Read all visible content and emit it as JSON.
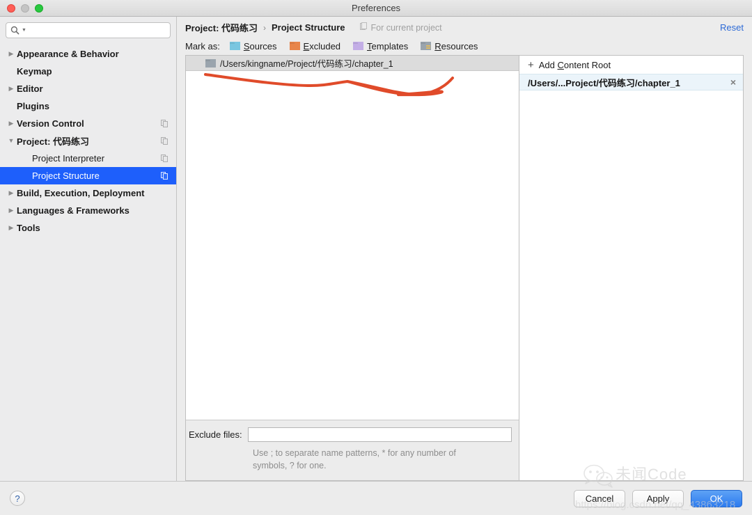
{
  "window": {
    "title": "Preferences",
    "traffic_lights": [
      "close-button",
      "minimize-button",
      "zoom-button"
    ]
  },
  "sidebar": {
    "search": {
      "value": "",
      "placeholder": "",
      "icon": "search-icon"
    },
    "items": [
      {
        "label": "Appearance & Behavior",
        "expandable": true,
        "expanded": false,
        "child": false,
        "selected": false,
        "badge": false
      },
      {
        "label": "Keymap",
        "expandable": false,
        "expanded": false,
        "child": false,
        "selected": false,
        "badge": false
      },
      {
        "label": "Editor",
        "expandable": true,
        "expanded": false,
        "child": false,
        "selected": false,
        "badge": false
      },
      {
        "label": "Plugins",
        "expandable": false,
        "expanded": false,
        "child": false,
        "selected": false,
        "badge": false
      },
      {
        "label": "Version Control",
        "expandable": true,
        "expanded": false,
        "child": false,
        "selected": false,
        "badge": true
      },
      {
        "label": "Project: 代码练习",
        "expandable": true,
        "expanded": true,
        "child": false,
        "selected": false,
        "badge": true
      },
      {
        "label": "Project Interpreter",
        "expandable": false,
        "expanded": false,
        "child": true,
        "selected": false,
        "badge": true
      },
      {
        "label": "Project Structure",
        "expandable": false,
        "expanded": false,
        "child": true,
        "selected": true,
        "badge": true
      },
      {
        "label": "Build, Execution, Deployment",
        "expandable": true,
        "expanded": false,
        "child": false,
        "selected": false,
        "badge": false
      },
      {
        "label": "Languages & Frameworks",
        "expandable": true,
        "expanded": false,
        "child": false,
        "selected": false,
        "badge": false
      },
      {
        "label": "Tools",
        "expandable": true,
        "expanded": false,
        "child": false,
        "selected": false,
        "badge": false
      }
    ]
  },
  "header": {
    "breadcrumb_parent": "Project: 代码练习",
    "breadcrumb_sep": "›",
    "breadcrumb_current": "Project Structure",
    "for_current_project": "For current project",
    "reset_label": "Reset"
  },
  "markas": {
    "label": "Mark as:",
    "options": [
      {
        "pre": "",
        "mnemonic": "S",
        "post": "ources",
        "color": "#79c6e0",
        "icon": "folder-sources-icon"
      },
      {
        "pre": "",
        "mnemonic": "E",
        "post": "xcluded",
        "color": "#e8854a",
        "icon": "folder-excluded-icon"
      },
      {
        "pre": "",
        "mnemonic": "T",
        "post": "emplates",
        "color": "#c3aee6",
        "icon": "folder-templates-icon"
      },
      {
        "pre": "",
        "mnemonic": "R",
        "post": "esources",
        "color": "#9aa4ad",
        "icon": "folder-resources-icon"
      }
    ]
  },
  "left_pane": {
    "root_path": "/Users/kingname/Project/代码练习/chapter_1",
    "root_icon": "folder-icon"
  },
  "exclude": {
    "label": "Exclude files:",
    "value": "",
    "placeholder": "",
    "hint_line1": "Use ; to separate name patterns, * for any number of",
    "hint_line2": "symbols, ? for one."
  },
  "right_pane": {
    "add_content_root": {
      "pre": "Add ",
      "mnemonic": "C",
      "post": "ontent Root",
      "plus": "+"
    },
    "content_roots": [
      {
        "path": "/Users/...Project/代码练习/chapter_1",
        "remove_icon": "close-icon",
        "selected": true
      }
    ]
  },
  "footer": {
    "help_label": "?",
    "cancel_label": "Cancel",
    "apply_label": "Apply",
    "ok_label": "OK"
  },
  "annotation": {
    "color": "#e04b2a",
    "description": "hand-drawn-red-underline"
  },
  "watermark": {
    "brand": "未闻Code",
    "url": "https://blog.csdn.net/qq_43863218",
    "logo": "wechat-icon"
  },
  "colors": {
    "accent": "#1e5ffb",
    "link": "#2d6ad6",
    "primary_button": "#2c7bef",
    "selected_root_bg": "#ebf4fa"
  }
}
